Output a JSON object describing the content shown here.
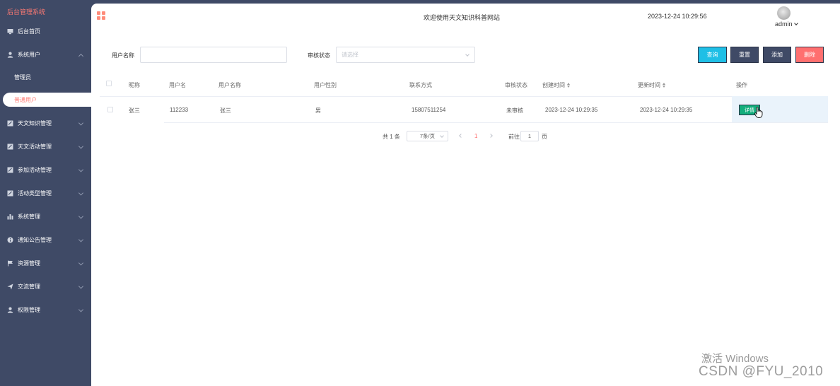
{
  "sidebar": {
    "brand": "后台管理系统",
    "items": [
      {
        "label": "后台首页",
        "icon": "monitor-icon"
      },
      {
        "label": "系统用户",
        "icon": "user-icon"
      },
      {
        "label": "管理员"
      },
      {
        "label": "普通用户"
      },
      {
        "label": "天文知识管理",
        "icon": "doc-icon"
      },
      {
        "label": "天文活动管理",
        "icon": "doc-icon"
      },
      {
        "label": "参加活动管理",
        "icon": "doc-icon"
      },
      {
        "label": "活动类型管理",
        "icon": "doc-icon"
      },
      {
        "label": "系统管理",
        "icon": "bar-chart-icon"
      },
      {
        "label": "通知公告管理",
        "icon": "info-icon"
      },
      {
        "label": "资源管理",
        "icon": "flag-icon"
      },
      {
        "label": "交流管理",
        "icon": "send-icon"
      },
      {
        "label": "权限管理",
        "icon": "user-icon"
      }
    ],
    "accent_color": "#ff7a73"
  },
  "header": {
    "welcome": "欢迎使用天文知识科普网站",
    "datetime": "2023-12-24 10:29:56",
    "user": "admin"
  },
  "search": {
    "username_label": "用户名称",
    "username_value": "",
    "status_label": "审核状态",
    "status_placeholder": "请选择"
  },
  "buttons": {
    "query": "查询",
    "reset": "重置",
    "add": "添加",
    "delete": "删除",
    "query_color": "#1fbfe6",
    "reset_color": "#3f4a66",
    "add_color": "#3f4a66",
    "delete_color": "#ff6f6f"
  },
  "table": {
    "columns": [
      "昵称",
      "用户名",
      "用户名称",
      "用户性别",
      "联系方式",
      "审核状态",
      "创建时间",
      "更新时间",
      "操作"
    ],
    "rows": [
      {
        "nickname": "张三",
        "username": "112233",
        "name": "张三",
        "gender": "男",
        "phone": "15807511254",
        "status": "未审核",
        "created": "2023-12-24 10:29:35",
        "updated": "2023-12-24 10:29:35",
        "action": "详情"
      }
    ]
  },
  "pagination": {
    "total": "共 1 条",
    "page_size": "7条/页",
    "current_page": "1",
    "goto_label": "前往",
    "goto_value": "1",
    "page_suffix": "页"
  },
  "watermark": {
    "line1": "激活 Windows",
    "line2": "CSDN @FYU_2010"
  }
}
